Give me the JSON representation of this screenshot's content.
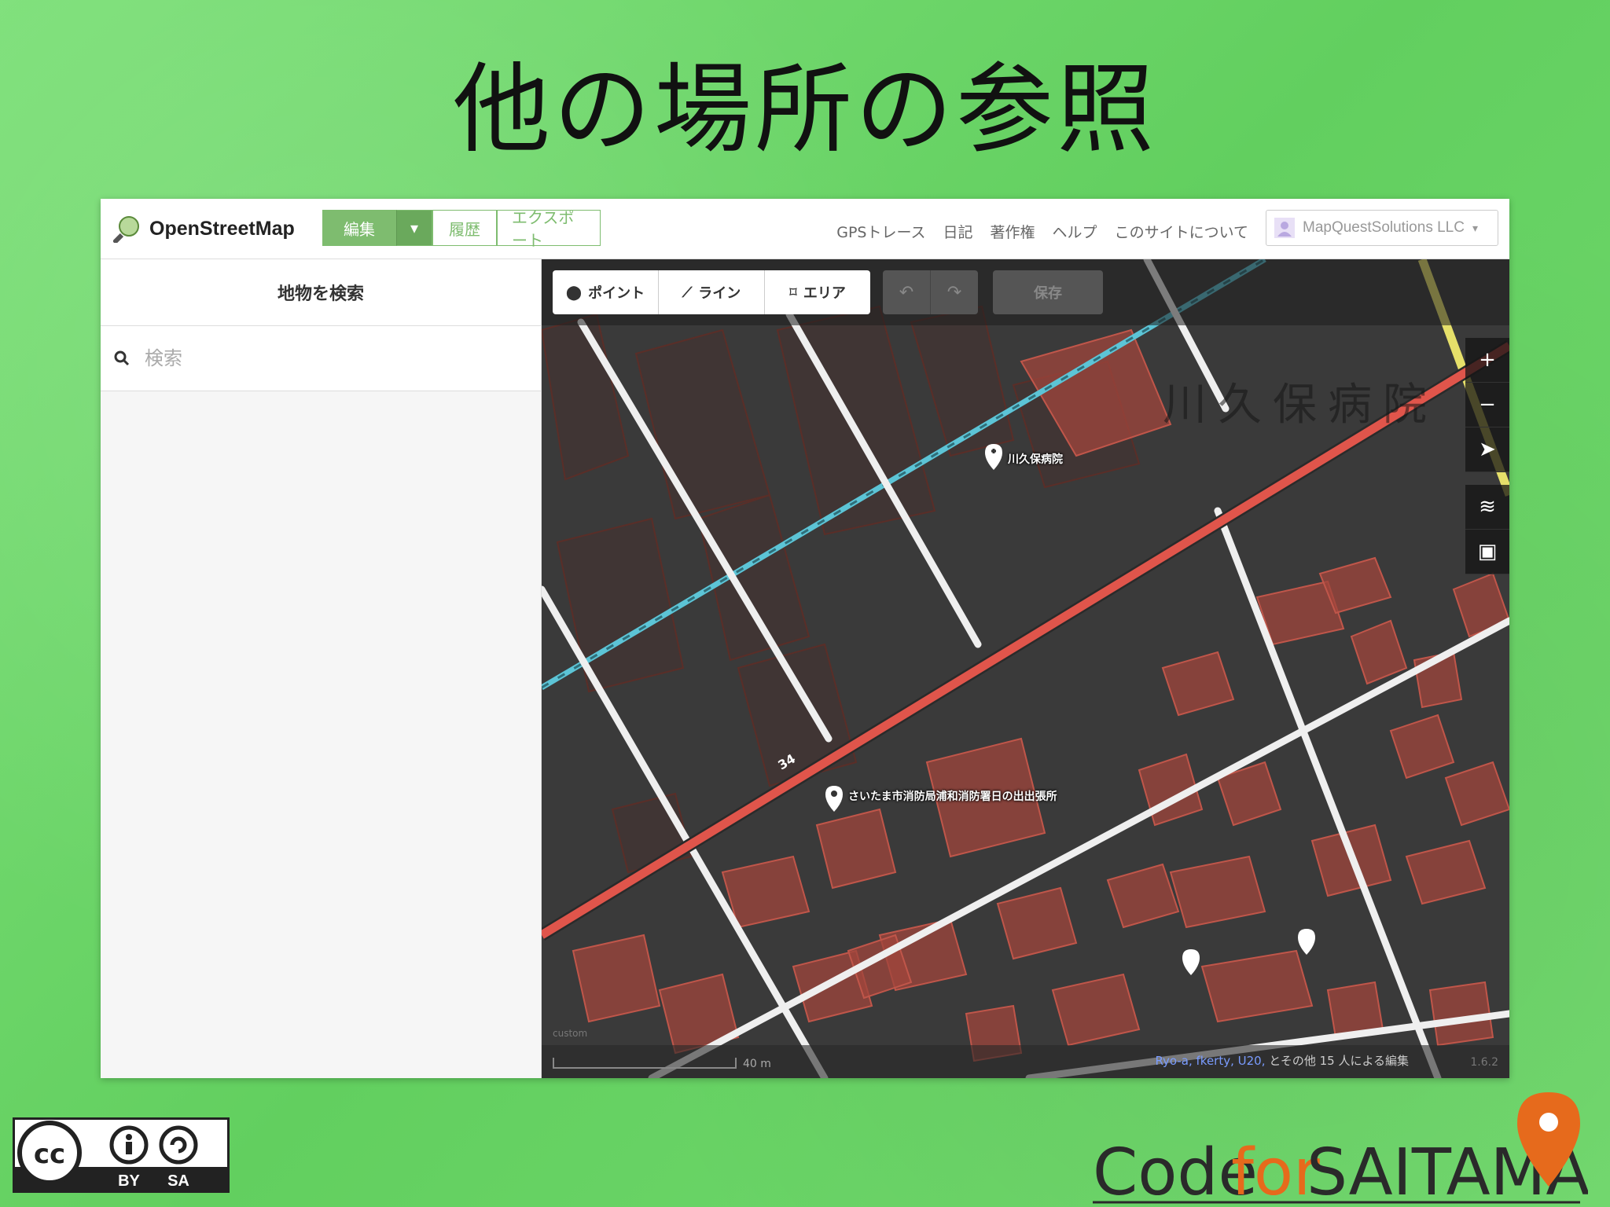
{
  "slide": {
    "title": "他の場所の参照"
  },
  "osm": {
    "brand": "OpenStreetMap",
    "tabs": {
      "edit": "編集",
      "history": "履歴",
      "export": "エクスポート"
    },
    "nav": [
      "GPSトレース",
      "日記",
      "著作権",
      "ヘルプ",
      "このサイトについて"
    ],
    "user": "MapQuestSolutions LLC"
  },
  "sidebar": {
    "title": "地物を検索",
    "search_placeholder": "検索"
  },
  "editor": {
    "tools": {
      "point": "ポイント",
      "line": "ライン",
      "area": "エリア"
    },
    "save": "保存",
    "labels": {
      "hospital": "川久保病院",
      "hospital_big": "川久保病院",
      "fire_station": "さいたま市消防局浦和消防署日の出出張所",
      "road_ref": "34"
    },
    "imagery": "custom",
    "scale": "40 m",
    "attribution": {
      "users": "Ryo-a, fkerty, U20,",
      "rest": "とその他 15 人による編集"
    },
    "version": "1.6.2"
  },
  "license": {
    "by": "BY",
    "sa": "SA",
    "cc": "cc"
  },
  "logo": {
    "code": "Code",
    "for": "for",
    "saitama": "SAITAMA"
  },
  "colors": {
    "osm_green": "#7ebc6f",
    "primary_road": "#e0554b",
    "railway": "#5cc4d6",
    "building": "#a0463c"
  }
}
